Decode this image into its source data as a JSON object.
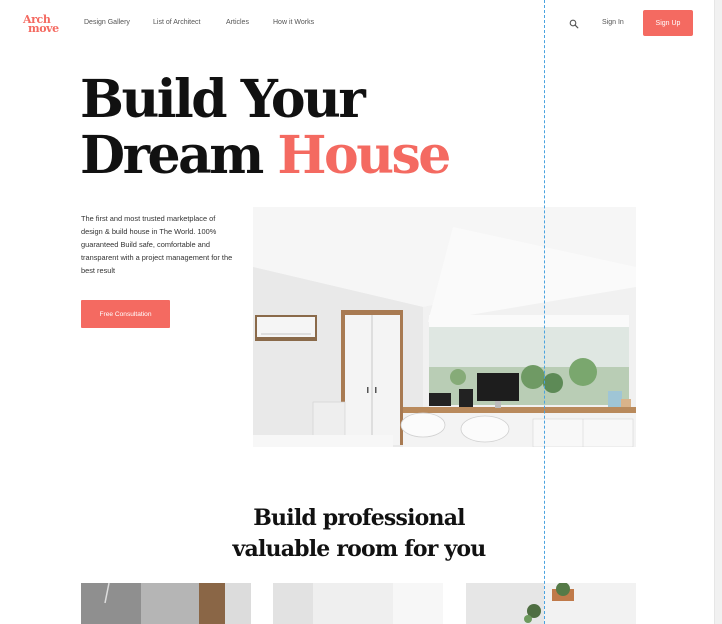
{
  "header": {
    "logo_line1": "Arch",
    "logo_line2": "move",
    "nav": [
      {
        "label": "Design Gallery"
      },
      {
        "label": "List of Architect"
      },
      {
        "label": "Articles"
      },
      {
        "label": "How it Works"
      }
    ],
    "search_icon": "search-icon",
    "signin_label": "Sign In",
    "signup_label": "Sign Up"
  },
  "hero": {
    "title_line1": "Build Your",
    "title_line2_a": "Dream ",
    "title_line2_b": "House",
    "description": "The first and most trusted marketplace of design & build house in The World. 100% guaranteed Build safe, comfortable and transparent with a project management for the best result",
    "cta_label": "Free Consultation"
  },
  "section": {
    "title_line1": "Build professional",
    "title_line2": "valuable room for you"
  },
  "colors": {
    "accent": "#f46a61",
    "guide": "#4aa3df"
  }
}
